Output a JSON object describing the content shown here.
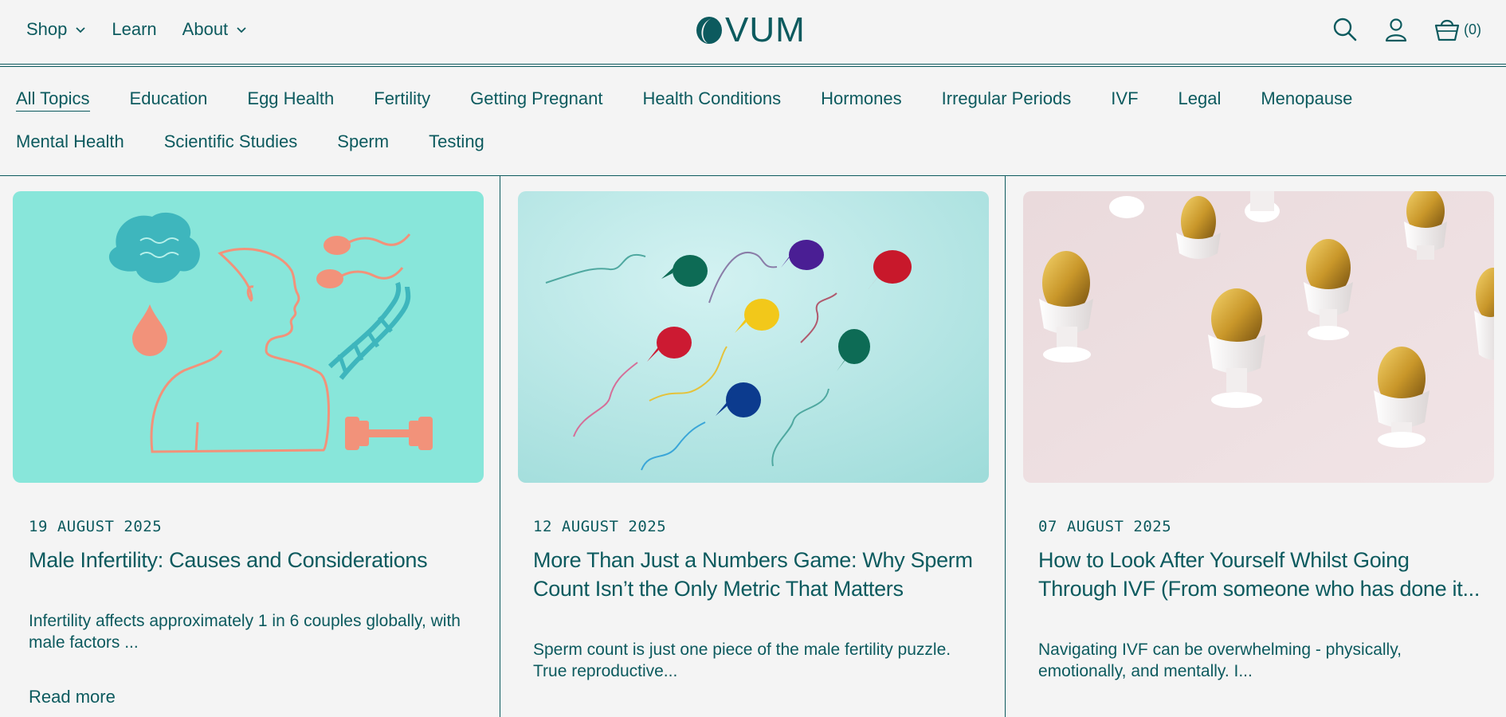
{
  "header": {
    "nav": [
      {
        "label": "Shop",
        "dropdown": true
      },
      {
        "label": "Learn",
        "dropdown": false
      },
      {
        "label": "About",
        "dropdown": true
      }
    ],
    "logo_text": "VUM",
    "cart_count": "(0)",
    "icons": [
      "search-icon",
      "account-icon",
      "cart-icon"
    ]
  },
  "topics": {
    "row1": [
      "All Topics",
      "Education",
      "Egg Health",
      "Fertility",
      "Getting Pregnant",
      "Health Conditions",
      "Hormones",
      "Irregular Periods",
      "IVF",
      "Legal",
      "Menopause"
    ],
    "row2": [
      "Mental Health",
      "Scientific Studies",
      "Sperm",
      "Testing"
    ],
    "active": "All Topics"
  },
  "articles": [
    {
      "date": "19 AUGUST 2025",
      "title": "Male Infertility: Causes and Considerations",
      "excerpt": "Infertility affects approximately 1 in 6 couples globally, with male factors ...",
      "read_more": "Read more"
    },
    {
      "date": "12 AUGUST 2025",
      "title": "More Than Just a Numbers Game: Why Sperm Count Isn’t the Only Metric That Matters",
      "excerpt": "Sperm count is just one piece of the male fertility puzzle. True reproductive..."
    },
    {
      "date": "07 AUGUST 2025",
      "title": "How to Look After Yourself Whilst Going Through IVF (From someone who has done it...",
      "excerpt": "Navigating IVF can be overwhelming - physically, emotionally, and mentally. I..."
    }
  ],
  "colors": {
    "brand": "#0c5a5e",
    "background": "#f4f4f4",
    "illustration_bg": "#88e6da",
    "balloon_bg": "#b9e9e8",
    "egg_bg": "#ecdee0"
  }
}
